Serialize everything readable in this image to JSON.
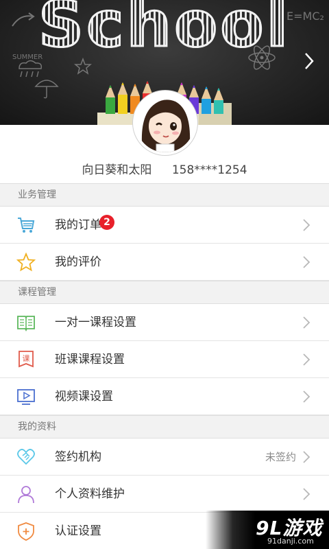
{
  "banner": {
    "title": "School",
    "doodle_formula": "E=MC₂",
    "doodle_summer": "SUMMER"
  },
  "profile": {
    "name": "向日葵和太阳",
    "phone": "158****1254"
  },
  "sections": [
    {
      "title": "业务管理",
      "items": [
        {
          "label": "我的订单",
          "icon": "cart-icon",
          "badge": "2"
        },
        {
          "label": "我的评价",
          "icon": "star-icon"
        }
      ]
    },
    {
      "title": "课程管理",
      "items": [
        {
          "label": "一对一课程设置",
          "icon": "book-icon"
        },
        {
          "label": "班课课程设置",
          "icon": "class-icon",
          "icon_text": "课"
        },
        {
          "label": "视频课设置",
          "icon": "video-icon"
        }
      ]
    },
    {
      "title": "我的资料",
      "items": [
        {
          "label": "签约机构",
          "icon": "handshake-icon",
          "status": "未签约"
        },
        {
          "label": "个人资料维护",
          "icon": "person-icon"
        },
        {
          "label": "认证设置",
          "icon": "shield-icon"
        }
      ]
    }
  ],
  "watermark": {
    "logo": "9L游戏",
    "url": "91danji.com"
  },
  "colors": {
    "badge": "#e8202a",
    "cart": "#4aa8d8",
    "star": "#f0b020",
    "book": "#5cb85c",
    "class": "#e05a4a",
    "video": "#4a6fd0",
    "handshake": "#5bc8e8",
    "person": "#b07ad8",
    "shield": "#f08a40"
  }
}
